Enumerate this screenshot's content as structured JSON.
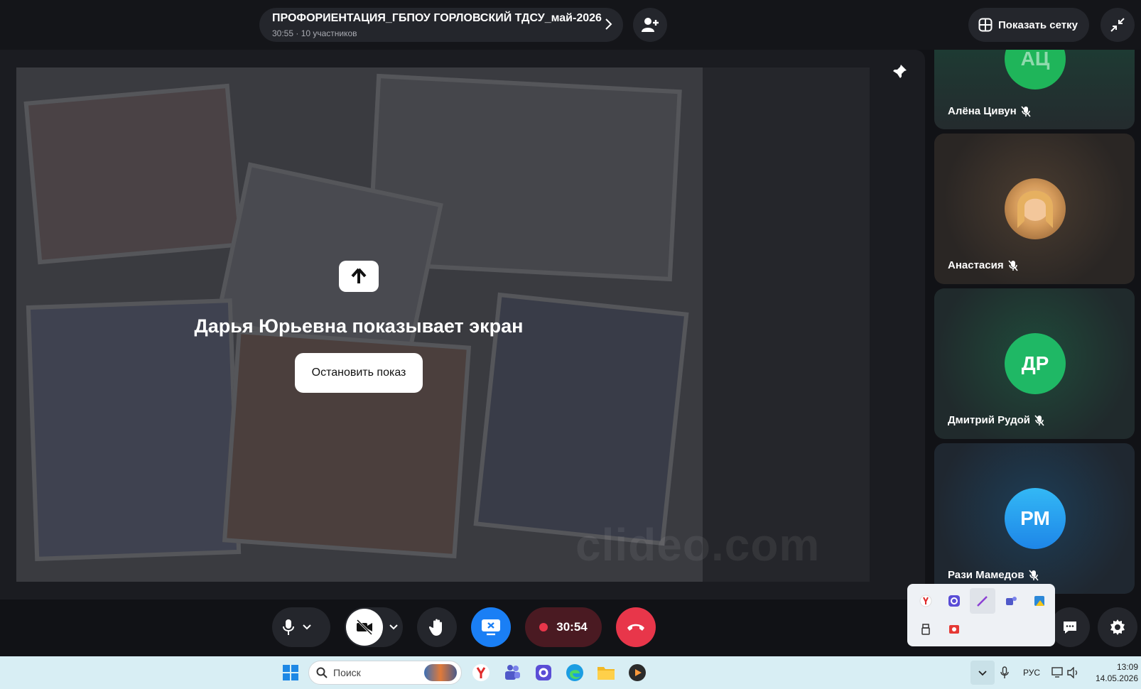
{
  "meeting": {
    "title": "ПРОФОРИЕНТАЦИЯ_ГБПОУ ГОРЛОВСКИЙ ТДСУ_май-2026",
    "subtitle": "30:55 · 10 участников",
    "show_grid_label": "Показать сетку"
  },
  "share": {
    "message": "Дарья Юрьевна показывает экран",
    "stop_label": "Остановить показ",
    "watermark": "clideo.com"
  },
  "participants": [
    {
      "name": "Алёна Цивун",
      "initials": "АЦ",
      "muted": true
    },
    {
      "name": "Анастасия",
      "initials": "",
      "muted": true
    },
    {
      "name": "Дмитрий Рудой",
      "initials": "ДР",
      "muted": true
    },
    {
      "name": "Рази Мамедов",
      "initials": "РМ",
      "muted": true
    }
  ],
  "controls": {
    "recording_time": "30:54"
  },
  "taskbar": {
    "search_placeholder": "Поиск",
    "language": "РУС",
    "time": "13:09",
    "date": "14.05.2026"
  },
  "colors": {
    "accent_blue": "#1a7ff5",
    "hangup_red": "#e8364a",
    "record_bg": "#4a1a22"
  }
}
